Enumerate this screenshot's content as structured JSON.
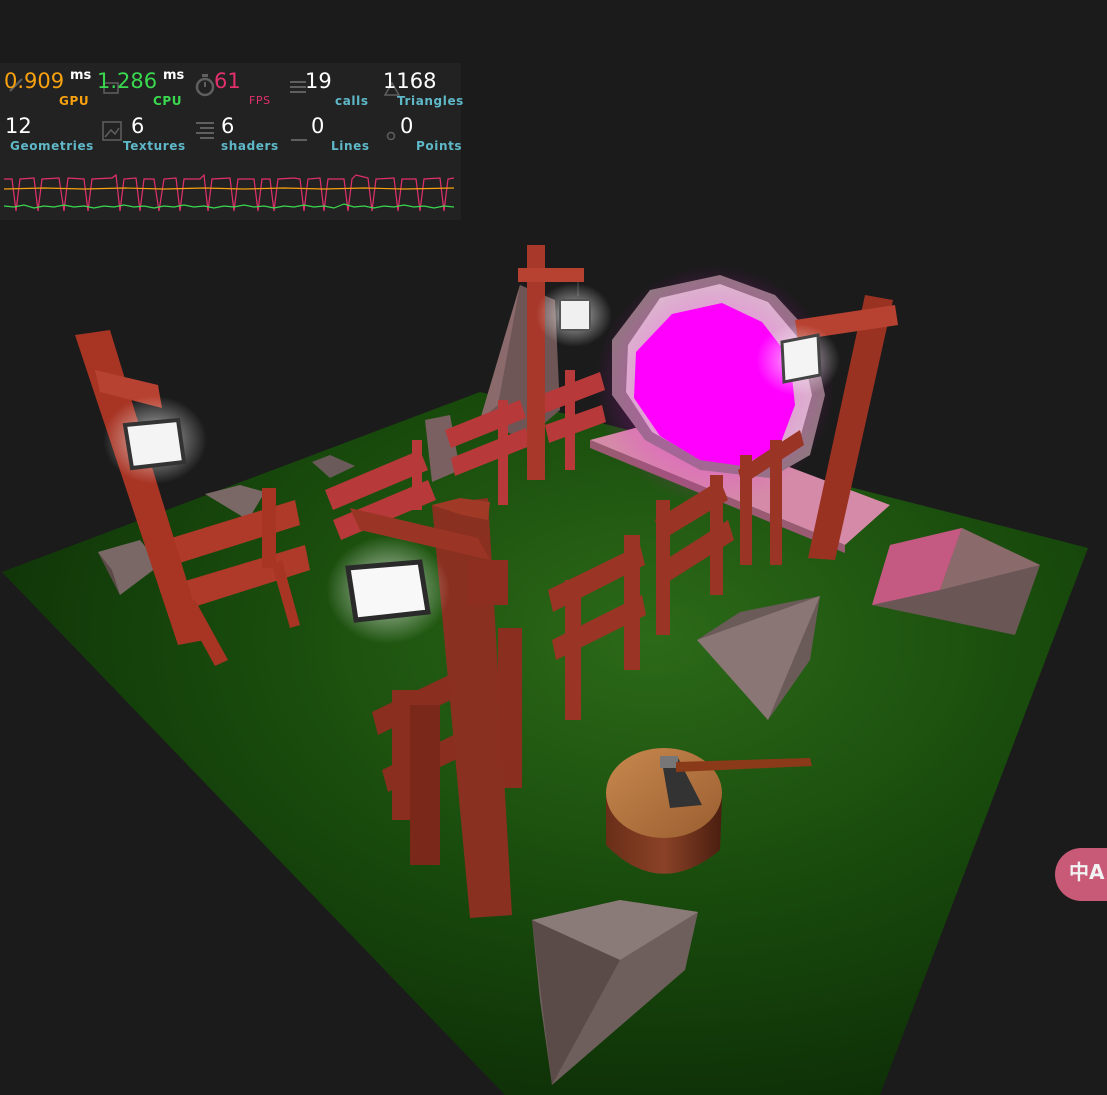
{
  "stats": {
    "gpu": {
      "value": "0.909",
      "unit": "ms",
      "label": "GPU",
      "color": "#f7a10f"
    },
    "cpu": {
      "value": "1.286",
      "unit": "ms",
      "label": "CPU",
      "color": "#3ad84f"
    },
    "fps": {
      "value": "61",
      "label": "FPS",
      "color": "#e2306c"
    },
    "calls": {
      "value": "19",
      "label": "calls"
    },
    "triangles": {
      "value": "1168",
      "label": "Triangles"
    },
    "geometries": {
      "value": "12",
      "label": "Geometries"
    },
    "textures": {
      "value": "6",
      "label": "Textures"
    },
    "shaders": {
      "value": "6",
      "label": "shaders"
    },
    "lines": {
      "value": "0",
      "label": "Lines"
    },
    "points": {
      "value": "0",
      "label": "Points"
    },
    "label_color": "#5fb8c8"
  },
  "translate_button": {
    "label": "中A",
    "icon": "translate-icon",
    "color": "#c85a78"
  },
  "scene": {
    "ground_color": "#1e5a12",
    "portal_color": "#ff00ff",
    "wood_color": "#b43a2a",
    "rock_color": "#6e5a58",
    "lantern_color": "#ffffff"
  }
}
